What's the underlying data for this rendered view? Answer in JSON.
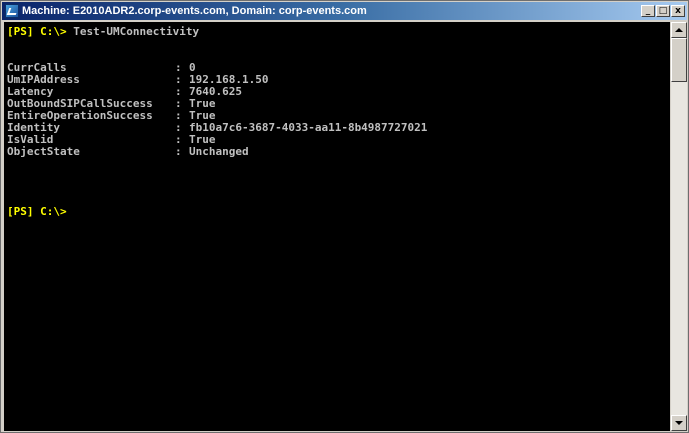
{
  "window": {
    "title": "Machine: E2010ADR2.corp-events.com, Domain: corp-events.com",
    "buttons": {
      "minimize": "_",
      "maximize": "□",
      "close": "x"
    }
  },
  "console": {
    "first_prompt": "[PS] C:\\>",
    "command": " Test-UMConnectivity",
    "results": [
      {
        "key": "CurrCalls",
        "value": "0"
      },
      {
        "key": "UmIPAddress",
        "value": "192.168.1.50"
      },
      {
        "key": "Latency",
        "value": "7640.625"
      },
      {
        "key": "OutBoundSIPCallSuccess",
        "value": "True"
      },
      {
        "key": "EntireOperationSuccess",
        "value": "True"
      },
      {
        "key": "Identity",
        "value": "fb10a7c6-3687-4033-aa11-8b4987727021"
      },
      {
        "key": "IsValid",
        "value": "True"
      },
      {
        "key": "ObjectState",
        "value": "Unchanged"
      }
    ],
    "separator": ":",
    "second_prompt": "[PS] C:\\>"
  },
  "colors": {
    "console_background": "#000000",
    "console_text": "#c0c0c0",
    "prompt": "#ffff00"
  }
}
